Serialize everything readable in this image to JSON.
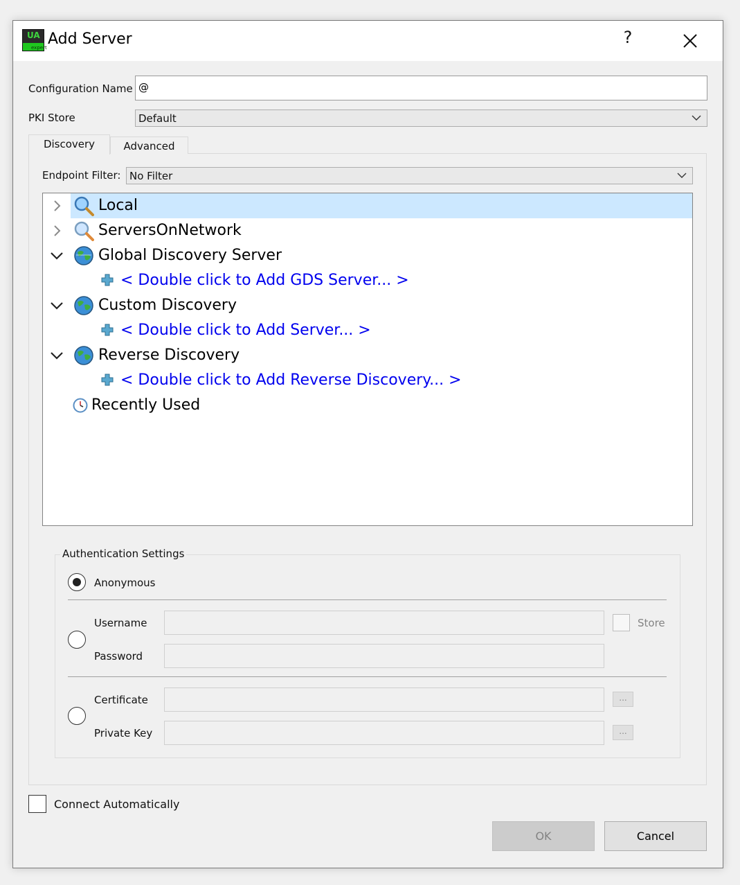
{
  "window": {
    "title": "Add Server",
    "help_label": "?"
  },
  "form": {
    "config_name_label": "Configuration Name",
    "config_name_value": "@",
    "pki_store_label": "PKI Store",
    "pki_store_value": "Default"
  },
  "tabs": [
    {
      "label": "Discovery",
      "active": true
    },
    {
      "label": "Advanced",
      "active": false
    }
  ],
  "endpoint_filter": {
    "label": "Endpoint Filter:",
    "value": "No Filter"
  },
  "tree": {
    "local": "Local",
    "servers_on_network": "ServersOnNetwork",
    "gds": "Global Discovery Server",
    "gds_add": "< Double click to Add GDS Server... >",
    "custom": "Custom Discovery",
    "custom_add": "< Double click to Add Server... >",
    "reverse": "Reverse Discovery",
    "reverse_add": "< Double click to Add Reverse Discovery... >",
    "recent": "Recently Used"
  },
  "auth": {
    "title": "Authentication Settings",
    "anonymous": "Anonymous",
    "username": "Username",
    "password": "Password",
    "store": "Store",
    "certificate": "Certificate",
    "private_key": "Private Key",
    "browse_label": "..."
  },
  "footer": {
    "connect_auto": "Connect Automatically",
    "ok": "OK",
    "cancel": "Cancel"
  },
  "colors": {
    "selection": "#cce8ff",
    "link": "#0000ee"
  }
}
